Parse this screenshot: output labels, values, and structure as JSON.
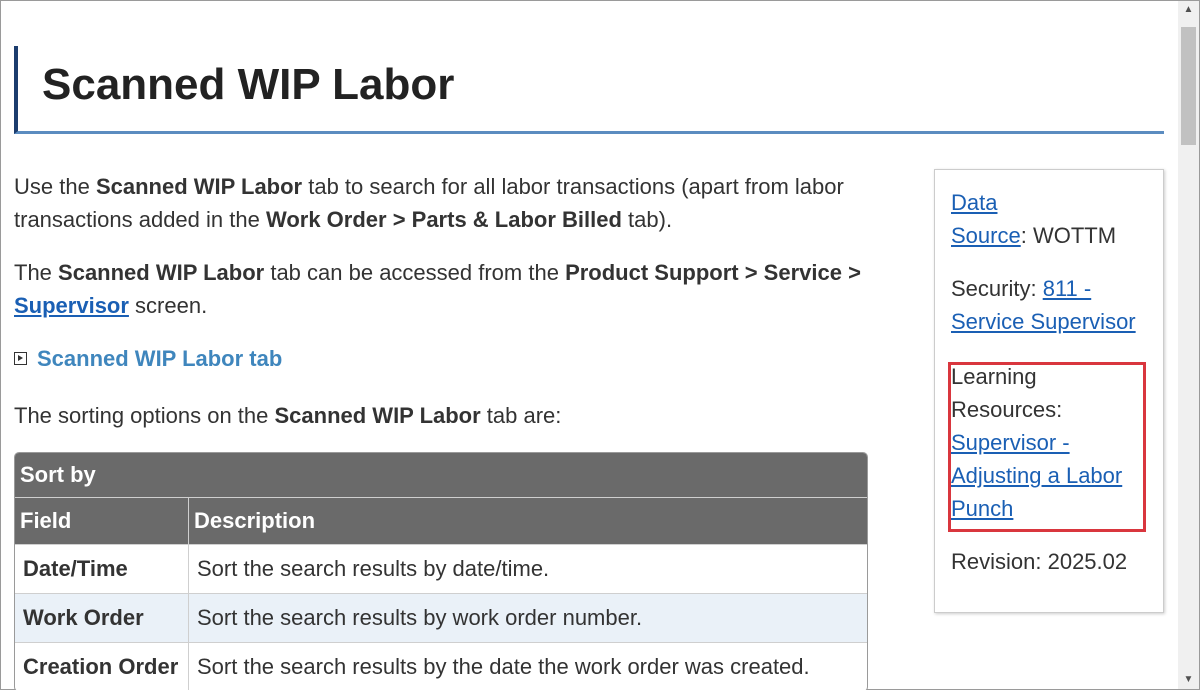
{
  "page": {
    "title": "Scanned WIP Labor"
  },
  "intro": {
    "p1_a": "Use the ",
    "p1_b": "Scanned WIP Labor",
    "p1_c": " tab to search for all labor transactions (apart from labor transactions added in the ",
    "p1_d": "Work Order > Parts & Labor Billed",
    "p1_e": " tab).",
    "p2_a": "The ",
    "p2_b": "Scanned WIP Labor",
    "p2_c": " tab can be accessed from the ",
    "p2_d": "Product Support > Service > ",
    "p2_link": "Supervisor",
    "p2_e": " screen.",
    "toggle_label": "Scanned WIP Labor tab",
    "p3_a": "The sorting options on the ",
    "p3_b": "Scanned WIP Labor",
    "p3_c": " tab are:"
  },
  "sort_table": {
    "caption": "Sort by",
    "headers": [
      "Field",
      "Description"
    ],
    "rows": [
      {
        "field": "Date/Time",
        "description": "Sort the search results by date/time."
      },
      {
        "field": "Work Order",
        "description": "Sort the search results by work order number."
      },
      {
        "field": "Creation Order",
        "description": "Sort the search results by the date the work order was created."
      }
    ]
  },
  "sidebar": {
    "data_source_link_1": "Data",
    "data_source_link_2": "Source",
    "data_source_value": ": WOTTM",
    "security_label": "Security: ",
    "security_link_1": "811 -",
    "security_link_2": "Service Supervisor",
    "learning_label_1": "Learning",
    "learning_label_2": "Resources:",
    "learning_link_1": "Supervisor -",
    "learning_link_2": "Adjusting a Labor",
    "learning_link_3": "Punch",
    "revision": "Revision: 2025.02"
  },
  "colors": {
    "title_border": "#1c3d6e",
    "title_underline": "#5b8cc0",
    "link": "#1a5fb4",
    "table_header": "#6a6a6a",
    "alt_row": "#eaf1f8",
    "highlight": "#d9363e"
  },
  "icons": {
    "toggle": "expand-triangle-icon",
    "scroll_up": "chevron-up-icon",
    "scroll_down": "chevron-down-icon"
  }
}
